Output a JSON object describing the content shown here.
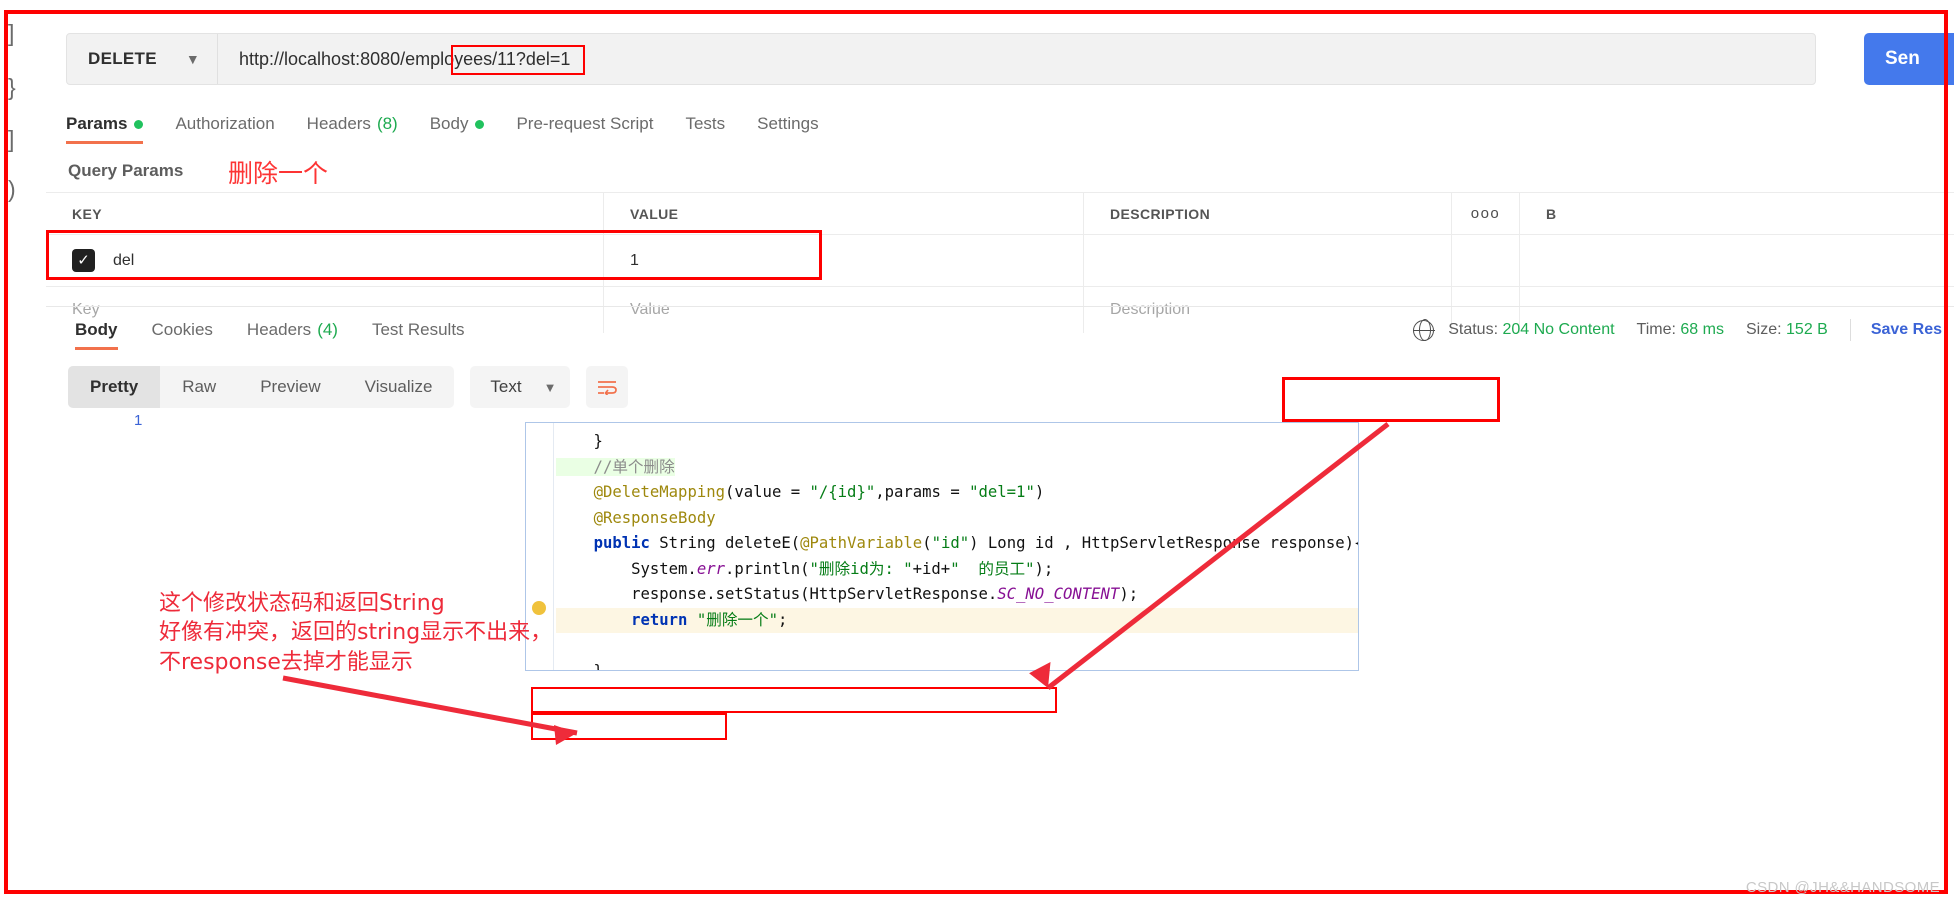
{
  "window": {
    "watermark": "CSDN @JH&&HANDSOME"
  },
  "sidebar": {
    "glyphs": [
      "]",
      "}",
      "]",
      ")"
    ]
  },
  "request": {
    "method": "DELETE",
    "method_chevron": "chevron-down-icon",
    "url": "http://localhost:8080/employees/11?del=1",
    "send_label": "Sen",
    "tabs": [
      {
        "label": "Params",
        "badge": "dot",
        "active": true
      },
      {
        "label": "Authorization",
        "badge": "",
        "active": false
      },
      {
        "label": "Headers",
        "count": "(8)",
        "badge": "",
        "active": false
      },
      {
        "label": "Body",
        "badge": "dot",
        "active": false
      },
      {
        "label": "Pre-request Script",
        "badge": "",
        "active": false
      },
      {
        "label": "Tests",
        "badge": "",
        "active": false
      },
      {
        "label": "Settings",
        "badge": "",
        "active": false
      }
    ]
  },
  "query_params": {
    "title": "Query Params",
    "annotation": "删除一个",
    "headers": [
      "KEY",
      "VALUE",
      "DESCRIPTION"
    ],
    "more_icon": "ooo",
    "bulk_label": "B",
    "rows": [
      {
        "checked": true,
        "key": "del",
        "value": "1",
        "description": ""
      }
    ],
    "placeholders": {
      "key": "Key",
      "value": "Value",
      "description": "Description"
    }
  },
  "response": {
    "tabs": [
      {
        "label": "Body",
        "active": true
      },
      {
        "label": "Cookies",
        "active": false
      },
      {
        "label": "Headers",
        "count": "(4)",
        "active": false
      },
      {
        "label": "Test Results",
        "active": false
      }
    ],
    "globe_icon": "globe-icon",
    "status_label": "Status:",
    "status_value": "204 No Content",
    "time_label": "Time:",
    "time_value": "68 ms",
    "size_label": "Size:",
    "size_value": "152 B",
    "save_response": "Save Res",
    "view_modes": [
      {
        "label": "Pretty",
        "active": true
      },
      {
        "label": "Raw",
        "active": false
      },
      {
        "label": "Preview",
        "active": false
      },
      {
        "label": "Visualize",
        "active": false
      }
    ],
    "format": "Text",
    "format_chevron": "chevron-down-icon",
    "wrap_icon": "wrap-lines-icon",
    "line_number": "1"
  },
  "annotation_note": {
    "line1": "这个修改状态码和返回String",
    "line2": "好像有冲突，返回的string显示不出来，",
    "line3": "不response去掉才能显示"
  },
  "code_snippet": {
    "lines": [
      "    }",
      "    //单个删除",
      "    @DeleteMapping(value = \"/{id}\",params = \"del=1\")",
      "    @ResponseBody",
      "    public String deleteE(@PathVariable(\"id\") Long id , HttpServletResponse response){",
      "        System.err.println(\"删除id为: \"+id+\"  的员工\");",
      "        response.setStatus(HttpServletResponse.SC_NO_CONTENT);",
      "        return \"删除一个\";",
      "",
      "    }"
    ]
  },
  "colors": {
    "accent_orange": "#f2714c",
    "send_blue": "#4479ec",
    "annotation_red": "#fe0000",
    "status_green": "#1eaa50"
  }
}
